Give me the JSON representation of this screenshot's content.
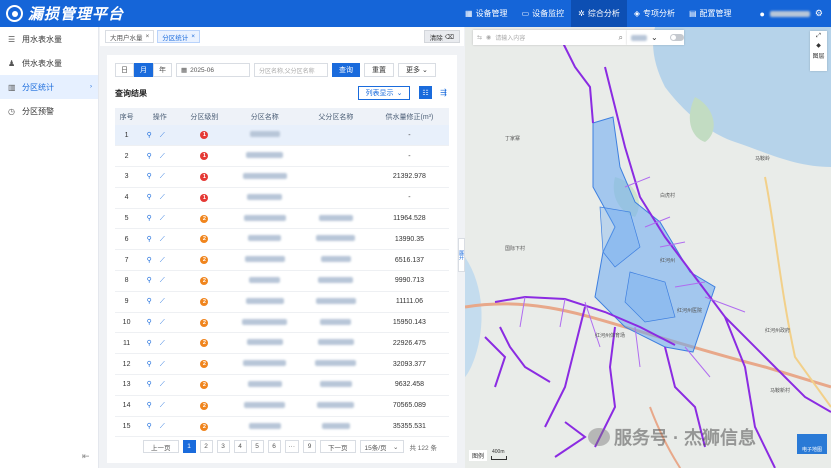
{
  "app": {
    "title": "漏损管理平台"
  },
  "nav": [
    {
      "label": "设备管理",
      "icon": "grid-icon"
    },
    {
      "label": "设备监控",
      "icon": "monitor-icon"
    },
    {
      "label": "综合分析",
      "icon": "gear-icon"
    },
    {
      "label": "专项分析",
      "icon": "shield-icon"
    },
    {
      "label": "配置管理",
      "icon": "calendar-icon"
    }
  ],
  "sidebar": [
    {
      "label": "用水表水量",
      "icon": "list-icon"
    },
    {
      "label": "供水表水量",
      "icon": "user-icon"
    },
    {
      "label": "分区统计",
      "icon": "chart-icon"
    },
    {
      "label": "分区预警",
      "icon": "clock-icon"
    }
  ],
  "tabs": [
    {
      "label": "大用户水量"
    },
    {
      "label": "分区统计"
    }
  ],
  "clear_label": "清除",
  "filter": {
    "day": "日",
    "month": "月",
    "year": "年",
    "date": "2025-06",
    "keyword_placeholder": "分区名称,父分区名称",
    "search": "查询",
    "reset": "重置",
    "more": "更多"
  },
  "results": {
    "title": "查询结果",
    "list_display": "列表显示"
  },
  "table": {
    "headers": [
      "序号",
      "操作",
      "分区级别",
      "分区名称",
      "父分区名称",
      "供水量修正(m³)"
    ],
    "rows": [
      {
        "no": "1",
        "level": "1",
        "value": "-"
      },
      {
        "no": "2",
        "level": "1",
        "value": "-"
      },
      {
        "no": "3",
        "level": "1",
        "value": "21392.978"
      },
      {
        "no": "4",
        "level": "1",
        "value": "-"
      },
      {
        "no": "5",
        "level": "2",
        "value": "11964.528"
      },
      {
        "no": "6",
        "level": "2",
        "value": "13990.35"
      },
      {
        "no": "7",
        "level": "2",
        "value": "6516.137"
      },
      {
        "no": "8",
        "level": "2",
        "value": "9990.713"
      },
      {
        "no": "9",
        "level": "2",
        "value": "11111.06"
      },
      {
        "no": "10",
        "level": "2",
        "value": "15950.143"
      },
      {
        "no": "11",
        "level": "2",
        "value": "22926.475"
      },
      {
        "no": "12",
        "level": "2",
        "value": "32093.377"
      },
      {
        "no": "13",
        "level": "2",
        "value": "9632.458"
      },
      {
        "no": "14",
        "level": "2",
        "value": "70565.089"
      },
      {
        "no": "15",
        "level": "2",
        "value": "35355.531"
      }
    ]
  },
  "pager": {
    "prev": "上一页",
    "next": "下一页",
    "pages": [
      "1",
      "2",
      "3",
      "4",
      "5",
      "6",
      "···",
      "9"
    ],
    "page_size": "15条/页",
    "total": "共 122 条"
  },
  "map": {
    "search_placeholder": "请输入内容",
    "legend": "图例",
    "scale": "400m",
    "layers": "图层",
    "map_type": "电子地图",
    "side_tab": "展开",
    "labels": [
      "丁家寨",
      "马鞍岭",
      "国际下村",
      "白虎村",
      "红河州",
      "红河州医院",
      "红河州政府",
      "红河州体育场",
      "马鞍新村"
    ]
  },
  "watermark": "服务号 · 杰狮信息",
  "colors": {
    "primary": "#1565d8",
    "accent": "#1a6bdc",
    "level1": "#e53935",
    "level2": "#f0851e",
    "pipe": "#8b2be2",
    "zone": "#6aa9f2"
  }
}
